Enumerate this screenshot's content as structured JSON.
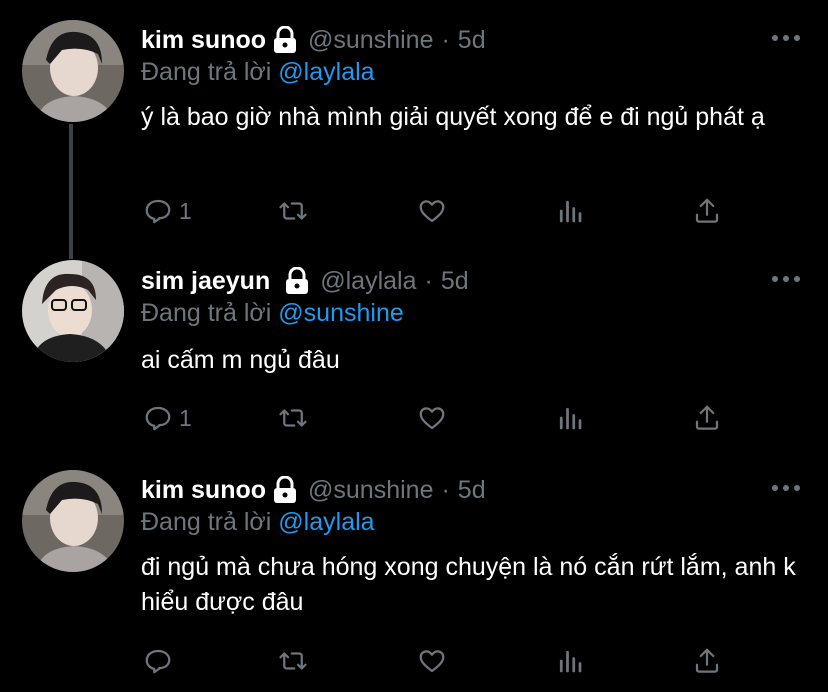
{
  "tweets": [
    {
      "name": "kim sunoo",
      "handle": "@sunshine",
      "time": "5d",
      "replying_prefix": "Đang trả lời",
      "replying_to": "@laylala",
      "text": "ý là bao giờ nhà mình giải quyết xong để e đi ngủ phát ạ",
      "reply_count": "1"
    },
    {
      "name": "sim jaeyun",
      "handle": "@laylala",
      "time": "5d",
      "replying_prefix": "Đang trả lời",
      "replying_to": "@sunshine",
      "text": "ai cấm m ngủ đâu",
      "reply_count": "1"
    },
    {
      "name": "kim sunoo",
      "handle": "@sunshine",
      "time": "5d",
      "replying_prefix": "Đang trả lời",
      "replying_to": "@laylala",
      "text": "đi ngủ mà chưa hóng xong chuyện là nó cắn rứt lắm, anh k hiểu được đâu",
      "reply_count": ""
    }
  ],
  "colors": {
    "background": "#000000",
    "muted": "#6e767d",
    "accent": "#1d9bf0",
    "thread_line": "#3e4144"
  },
  "icons": [
    "lock-icon",
    "more-icon",
    "reply-icon",
    "retweet-icon",
    "like-icon",
    "analytics-icon",
    "share-icon"
  ]
}
